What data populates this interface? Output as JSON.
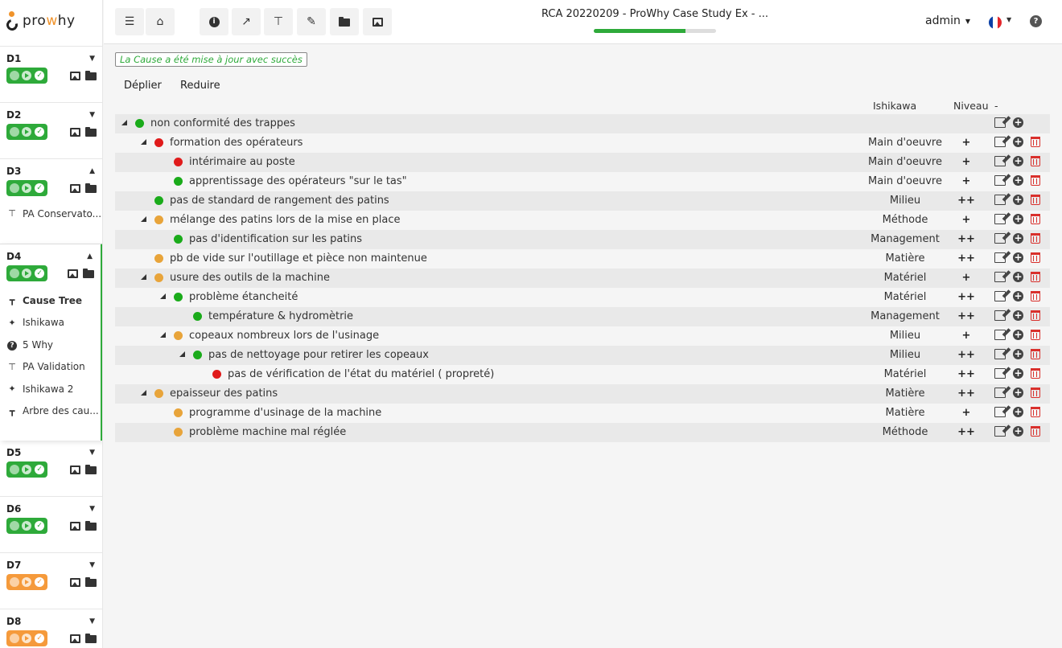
{
  "logo": {
    "text_a": "pro",
    "text_w": "w",
    "text_b": "hy"
  },
  "sidebar": {
    "sections": [
      {
        "label": "D1",
        "state": "green",
        "caret": "down"
      },
      {
        "label": "D2",
        "state": "green",
        "caret": "down"
      },
      {
        "label": "D3",
        "state": "green",
        "caret": "up",
        "links": [
          {
            "label": "PA Conservato...",
            "icon": "sitemap-icon"
          }
        ]
      },
      {
        "label": "D4",
        "state": "green",
        "caret": "up",
        "links": [
          {
            "label": "Cause Tree",
            "icon": "cause-tree-icon"
          },
          {
            "label": "Ishikawa",
            "icon": "fish-icon"
          },
          {
            "label": "5 Why",
            "icon": "question-circle-icon"
          },
          {
            "label": "PA Validation",
            "icon": "sitemap-icon"
          },
          {
            "label": "Ishikawa 2",
            "icon": "fish-icon"
          },
          {
            "label": "Arbre des cau...",
            "icon": "cause-tree-icon"
          }
        ]
      },
      {
        "label": "D5",
        "state": "green",
        "caret": "down"
      },
      {
        "label": "D6",
        "state": "green",
        "caret": "down"
      },
      {
        "label": "D7",
        "state": "orange",
        "caret": "down"
      },
      {
        "label": "D8",
        "state": "orange",
        "caret": "down"
      }
    ]
  },
  "topbar": {
    "title": "RCA 20220209 - ProWhy Case Study Ex - ...",
    "progress": 0.75,
    "user": "admin",
    "help": "?"
  },
  "alert": "La Cause a été mise à jour avec succès",
  "toggles": {
    "expand": "Déplier",
    "collapse": "Reduire"
  },
  "headers": {
    "ishikawa": "Ishikawa",
    "niveau": "Niveau",
    "minus": "-"
  },
  "colors": {
    "green": "#1aab1a",
    "red": "#e01b1b",
    "orange": "#e8a43a"
  },
  "tree": [
    {
      "label": "non conformité des trappes",
      "depth": 0,
      "color": "green",
      "expand": true,
      "category": "",
      "level": "",
      "alt": true,
      "delete": false
    },
    {
      "label": "formation des opérateurs",
      "depth": 1,
      "color": "red",
      "expand": true,
      "category": "Main d'oeuvre",
      "level": "+",
      "alt": false,
      "delete": true
    },
    {
      "label": "intérimaire au poste",
      "depth": 2,
      "color": "red",
      "expand": false,
      "category": "Main d'oeuvre",
      "level": "+",
      "alt": true,
      "delete": true
    },
    {
      "label": "apprentissage des opérateurs \"sur le tas\"",
      "depth": 2,
      "color": "green",
      "expand": false,
      "category": "Main d'oeuvre",
      "level": "+",
      "alt": false,
      "delete": true
    },
    {
      "label": "pas de standard de rangement des patins",
      "depth": 1,
      "color": "green",
      "expand": false,
      "category": "Milieu",
      "level": "++",
      "alt": true,
      "delete": true
    },
    {
      "label": "mélange des patins lors de la mise en place",
      "depth": 1,
      "color": "orange",
      "expand": true,
      "category": "Méthode",
      "level": "+",
      "alt": false,
      "delete": true
    },
    {
      "label": "pas d'identification sur les patins",
      "depth": 2,
      "color": "green",
      "expand": false,
      "category": "Management",
      "level": "++",
      "alt": true,
      "delete": true
    },
    {
      "label": "pb de vide sur l'outillage et pièce non maintenue",
      "depth": 1,
      "color": "orange",
      "expand": false,
      "category": "Matière",
      "level": "++",
      "alt": false,
      "delete": true
    },
    {
      "label": "usure des outils de la machine",
      "depth": 1,
      "color": "orange",
      "expand": true,
      "category": "Matériel",
      "level": "+",
      "alt": true,
      "delete": true
    },
    {
      "label": "problème étancheité",
      "depth": 2,
      "color": "green",
      "expand": true,
      "category": "Matériel",
      "level": "++",
      "alt": false,
      "delete": true
    },
    {
      "label": "température & hydromètrie",
      "depth": 3,
      "color": "green",
      "expand": false,
      "category": "Management",
      "level": "++",
      "alt": true,
      "delete": true
    },
    {
      "label": "copeaux nombreux lors de l'usinage",
      "depth": 2,
      "color": "orange",
      "expand": true,
      "category": "Milieu",
      "level": "+",
      "alt": false,
      "delete": true
    },
    {
      "label": "pas de nettoyage pour retirer les copeaux",
      "depth": 3,
      "color": "green",
      "expand": true,
      "category": "Milieu",
      "level": "++",
      "alt": true,
      "delete": true
    },
    {
      "label": "pas de vérification de l'état du matériel ( propreté)",
      "depth": 4,
      "color": "red",
      "expand": false,
      "category": "Matériel",
      "level": "++",
      "alt": false,
      "delete": true
    },
    {
      "label": "epaisseur des patins",
      "depth": 1,
      "color": "orange",
      "expand": true,
      "category": "Matière",
      "level": "++",
      "alt": true,
      "delete": true
    },
    {
      "label": "programme d'usinage de la machine",
      "depth": 2,
      "color": "orange",
      "expand": false,
      "category": "Matière",
      "level": "+",
      "alt": false,
      "delete": true
    },
    {
      "label": "problème machine mal réglée",
      "depth": 2,
      "color": "orange",
      "expand": false,
      "category": "Méthode",
      "level": "++",
      "alt": true,
      "delete": true
    }
  ]
}
